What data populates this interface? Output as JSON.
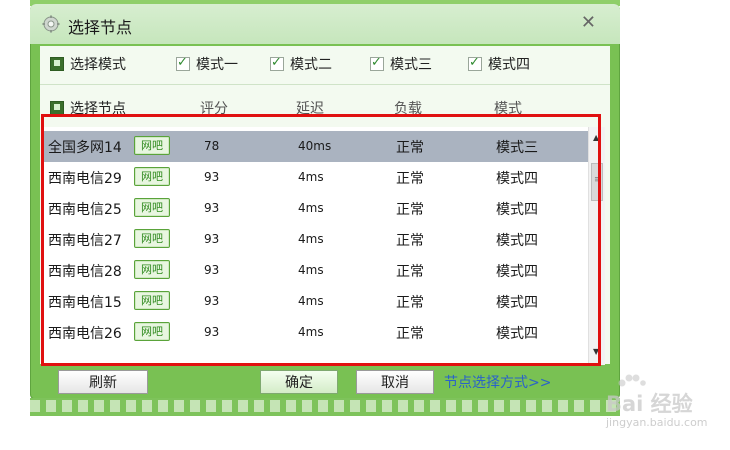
{
  "dialog": {
    "title": "选择节点",
    "close_glyph": "✕"
  },
  "modes": {
    "master_label": "选择模式",
    "items": [
      {
        "label": "模式一",
        "checked": true
      },
      {
        "label": "模式二",
        "checked": true
      },
      {
        "label": "模式三",
        "checked": true
      },
      {
        "label": "模式四",
        "checked": true
      }
    ]
  },
  "columns": {
    "node": "选择节点",
    "score": "评分",
    "latency": "延迟",
    "load": "负载",
    "mode": "模式"
  },
  "rows": [
    {
      "name": "全国多网14",
      "badge": "网吧",
      "score": "78",
      "latency": "40ms",
      "load": "正常",
      "mode": "模式三",
      "selected": true
    },
    {
      "name": "西南电信29",
      "badge": "网吧",
      "score": "93",
      "latency": "4ms",
      "load": "正常",
      "mode": "模式四",
      "selected": false
    },
    {
      "name": "西南电信25",
      "badge": "网吧",
      "score": "93",
      "latency": "4ms",
      "load": "正常",
      "mode": "模式四",
      "selected": false
    },
    {
      "name": "西南电信27",
      "badge": "网吧",
      "score": "93",
      "latency": "4ms",
      "load": "正常",
      "mode": "模式四",
      "selected": false
    },
    {
      "name": "西南电信28",
      "badge": "网吧",
      "score": "93",
      "latency": "4ms",
      "load": "正常",
      "mode": "模式四",
      "selected": false
    },
    {
      "name": "西南电信15",
      "badge": "网吧",
      "score": "93",
      "latency": "4ms",
      "load": "正常",
      "mode": "模式四",
      "selected": false
    },
    {
      "name": "西南电信26",
      "badge": "网吧",
      "score": "93",
      "latency": "4ms",
      "load": "正常",
      "mode": "模式四",
      "selected": false
    }
  ],
  "buttons": {
    "refresh": "刷新",
    "ok": "确定",
    "cancel": "取消",
    "link": "节点选择方式>>"
  },
  "watermark": {
    "text": "Bai 经验",
    "sub": "jingyan.baidu.com"
  },
  "colors": {
    "accent_green": "#79c153",
    "selected_row": "#aab3c0",
    "highlight_red": "#e01010",
    "link_blue": "#2a62c9"
  }
}
